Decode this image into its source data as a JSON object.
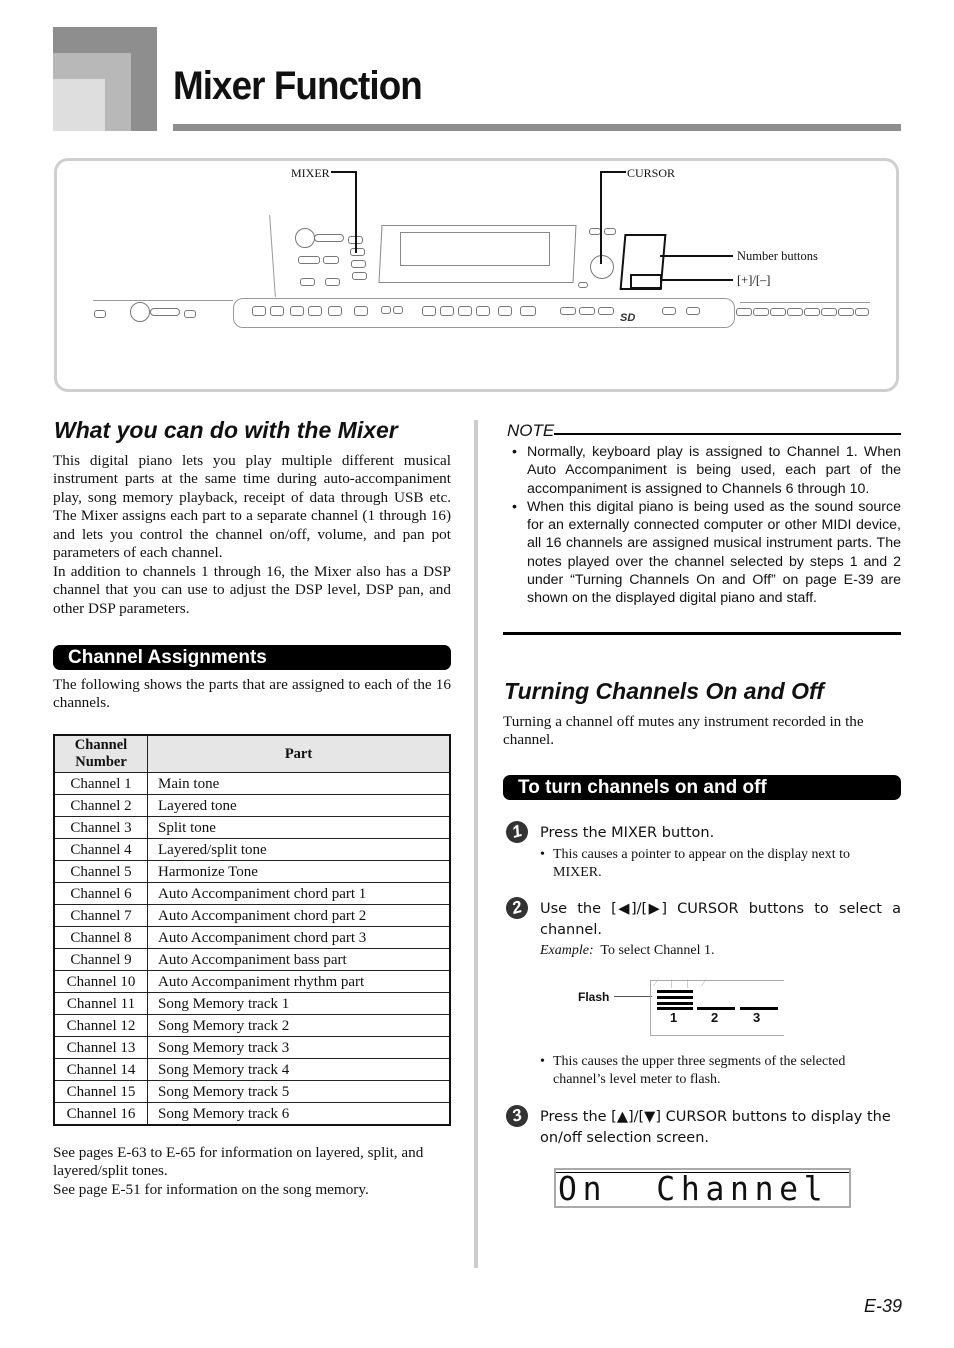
{
  "header": {
    "title": "Mixer Function"
  },
  "panel_illustration": {
    "callouts": {
      "mixer": "MIXER",
      "cursor": "CURSOR",
      "number_buttons": "Number buttons",
      "plus_minus": "[+]/[–]"
    }
  },
  "left": {
    "heading": "What you can do with the Mixer",
    "intro_p1": "This digital piano lets you play multiple different musical instrument parts at the same time during auto-accompaniment play, song memory playback, receipt of data through USB etc. The Mixer assigns each part to a separate channel (1 through 16) and lets you control the channel on/off, volume, and pan pot parameters of each channel.",
    "intro_p2": "In addition to channels 1 through 16, the Mixer also has a DSP channel that you can use to adjust the DSP level, DSP pan, and other DSP parameters.",
    "section_bar": "Channel Assignments",
    "section_intro": "The following shows the parts that are assigned to each of the 16 channels.",
    "table": {
      "headers": [
        "Channel Number",
        "Part"
      ],
      "rows": [
        [
          "Channel 1",
          "Main tone"
        ],
        [
          "Channel 2",
          "Layered tone"
        ],
        [
          "Channel 3",
          "Split tone"
        ],
        [
          "Channel 4",
          "Layered/split tone"
        ],
        [
          "Channel 5",
          "Harmonize Tone"
        ],
        [
          "Channel 6",
          "Auto Accompaniment chord part 1"
        ],
        [
          "Channel 7",
          "Auto Accompaniment chord part 2"
        ],
        [
          "Channel 8",
          "Auto Accompaniment chord part 3"
        ],
        [
          "Channel 9",
          "Auto Accompaniment bass part"
        ],
        [
          "Channel 10",
          "Auto Accompaniment rhythm part"
        ],
        [
          "Channel 11",
          "Song Memory track 1"
        ],
        [
          "Channel 12",
          "Song Memory track 2"
        ],
        [
          "Channel 13",
          "Song Memory track 3"
        ],
        [
          "Channel 14",
          "Song Memory track 4"
        ],
        [
          "Channel 15",
          "Song Memory track 5"
        ],
        [
          "Channel 16",
          "Song Memory track 6"
        ]
      ]
    },
    "footnote1": "See pages E-63 to E-65 for information on layered, split, and layered/split tones.",
    "footnote2": "See page E-51 for information on the song memory."
  },
  "right": {
    "note_label": "NOTE",
    "note_items": [
      "Normally, keyboard play is assigned to Channel 1. When Auto Accompaniment is being used, each part of the accompaniment is assigned to Channels 6 through 10.",
      "When this digital piano is being used as the sound source for an externally connected computer or other MIDI device, all 16 channels are assigned musical instrument parts. The notes played over the channel selected by steps 1 and 2 under “Turning Channels On and Off” on page E-39 are shown on the displayed digital piano and staff."
    ],
    "heading": "Turning Channels On and Off",
    "intro": "Turning a channel off mutes any instrument recorded in the channel.",
    "section_bar": "To turn channels on and off",
    "steps": [
      {
        "num": "1",
        "text": "Press the MIXER button.",
        "bullet": "This causes a pointer to appear on the display next to MIXER."
      },
      {
        "num": "2",
        "text": "Use the [◀]/[▶] CURSOR buttons to select a channel.",
        "example_label": "Example:",
        "example_text": "To select Channel 1.",
        "figure_label": "Flash",
        "meter_labels": [
          "1",
          "2",
          "3"
        ],
        "bullet": "This causes the upper three segments of the selected channel’s level meter to flash."
      },
      {
        "num": "3",
        "text": "Press the [▲]/[▼] CURSOR buttons to display the on/off selection screen.",
        "display_text": "On  Channel"
      }
    ]
  },
  "footer": {
    "page_number": "E-39"
  }
}
